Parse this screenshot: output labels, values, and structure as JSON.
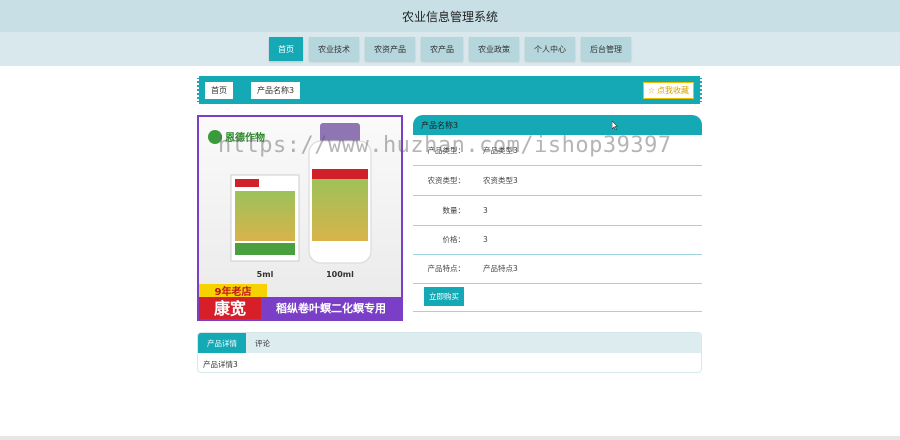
{
  "app": {
    "title": "农业信息管理系统"
  },
  "nav": {
    "items": [
      "首页",
      "农业技术",
      "农资产品",
      "农产品",
      "农业政策",
      "个人中心",
      "后台管理"
    ],
    "active_index": 0
  },
  "breadcrumb": {
    "home": "首页",
    "current": "产品名称3"
  },
  "favorite": {
    "label": "点我收藏"
  },
  "product": {
    "name": "产品名称3",
    "fields": [
      {
        "label": "产品类型：",
        "value": "产品类型3"
      },
      {
        "label": "农资类型：",
        "value": "农资类型3"
      },
      {
        "label": "数量：",
        "value": "3"
      },
      {
        "label": "价格：",
        "value": "3"
      },
      {
        "label": "产品特点：",
        "value": "产品特点3"
      }
    ],
    "buy_label": "立即购买",
    "image_text": {
      "logo": "恩德作物",
      "size_small": "5ml",
      "size_large": "100ml",
      "badge": "9年老店",
      "brand": "康宽",
      "slogan": "稻纵卷叶螟二化螟专用"
    }
  },
  "tabs": {
    "items": [
      "产品详情",
      "评论"
    ],
    "active_index": 0,
    "content": "产品详情3"
  },
  "watermark": "https://www.huzhan.com/ishop39397",
  "colors": {
    "accent": "#14a9b5",
    "nav_bg": "#d9e8ec",
    "title_bg": "#c8dfe5",
    "image_border": "#7a3fc6"
  }
}
